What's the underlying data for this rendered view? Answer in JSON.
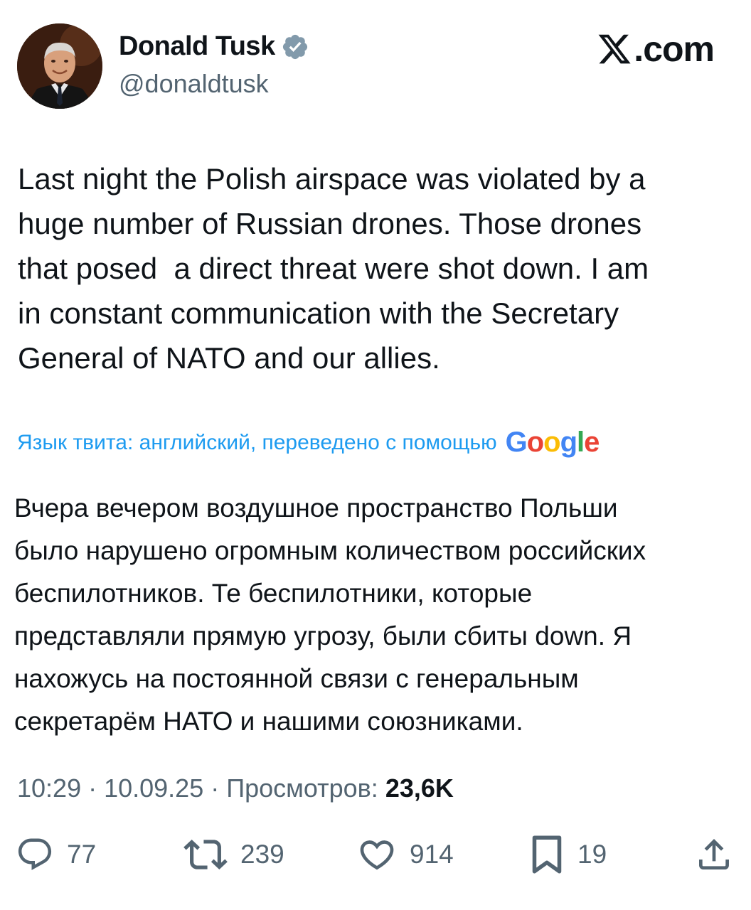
{
  "header": {
    "display_name": "Donald Tusk",
    "handle": "@donaldtusk",
    "brand_domain": ".com"
  },
  "icons": {
    "avatar": "profile-photo",
    "verified": "verified-badge-icon",
    "brand": "x-logo-icon",
    "reply": "reply-icon",
    "retweet": "retweet-icon",
    "like": "heart-icon",
    "bookmark": "bookmark-icon",
    "share": "share-icon"
  },
  "tweet": {
    "text": "Last night the Polish airspace was violated by a\nhuge number of Russian drones. Those drones\nthat posed  a direct threat were shot down. I am\nin constant communication with the Secretary\nGeneral of NATO and our allies.",
    "translation_label": "Язык твита: английский, переведено с помощью",
    "translation_provider": "Google",
    "translated_text": "Вчера вечером воздушное пространство Польши\nбыло нарушено огромным количеством российских\nбеспилотников. Те беспилотники, которые\nпредставляли прямую угрозу, были сбиты down. Я\nнахожусь на постоянной связи с генеральным\nсекретарём НАТО и нашими союзниками."
  },
  "meta": {
    "time": "10:29",
    "separator": " · ",
    "date": "10.09.25",
    "views_label": "Просмотров:",
    "views_count": "23,6K"
  },
  "actions": {
    "replies": "77",
    "reposts": "239",
    "likes": "914",
    "bookmarks": "19"
  },
  "colors": {
    "text": "#0f1419",
    "secondary": "#536471",
    "link": "#1d9bf0",
    "verified": "#829aab",
    "google_blue": "#4285f4",
    "google_red": "#ea4335",
    "google_yellow": "#fbbc05",
    "google_green": "#34a853"
  }
}
